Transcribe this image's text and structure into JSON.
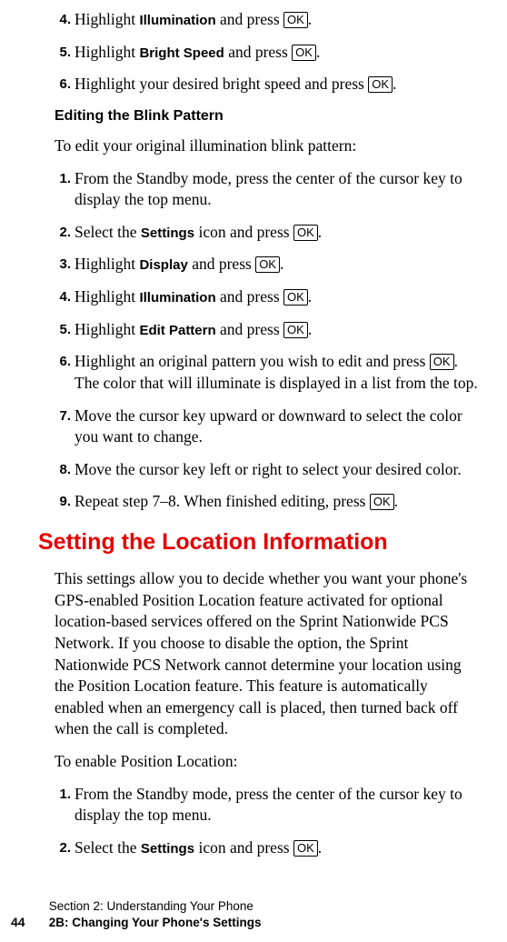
{
  "ok_label": "OK",
  "pre_steps": [
    {
      "n": "4.",
      "pre": "Highlight ",
      "bold": "Illumination",
      "mid": " and press ",
      "ok": true,
      "after": "."
    },
    {
      "n": "5.",
      "pre": "Highlight ",
      "bold": "Bright Speed",
      "mid": " and press ",
      "ok": true,
      "after": "."
    },
    {
      "n": "6.",
      "pre": "Highlight your desired bright speed and press ",
      "bold": "",
      "mid": "",
      "ok": true,
      "after": "."
    }
  ],
  "blink_heading": "Editing the Blink Pattern",
  "blink_intro": "To edit your original illumination blink pattern:",
  "blink_steps": [
    {
      "n": "1.",
      "text_a": "From the Standby mode, press the center of the cursor key to display the top menu."
    },
    {
      "n": "2.",
      "pre": "Select the ",
      "bold": "Settings",
      "mid": " icon and press ",
      "ok": true,
      "after": "."
    },
    {
      "n": "3.",
      "pre": "Highlight ",
      "bold": "Display",
      "mid": " and press ",
      "ok": true,
      "after": "."
    },
    {
      "n": "4.",
      "pre": "Highlight ",
      "bold": "Illumination",
      "mid": " and press ",
      "ok": true,
      "after": "."
    },
    {
      "n": "5.",
      "pre": "Highlight ",
      "bold": "Edit Pattern",
      "mid": " and press ",
      "ok": true,
      "after": "."
    },
    {
      "n": "6.",
      "pre": "Highlight an original pattern you wish to edit and press ",
      "ok": true,
      "after": ".",
      "line2": "The color that will illuminate is displayed in a list from the top."
    },
    {
      "n": "7.",
      "text_a": "Move the cursor key upward or downward to select the color you want to change."
    },
    {
      "n": "8.",
      "text_a": "Move the cursor key left or right to select your desired color."
    },
    {
      "n": "9.",
      "pre": "Repeat step 7–8. When finished editing, press ",
      "ok": true,
      "after": "."
    }
  ],
  "section_title": "Setting the Location Information",
  "section_para": "This settings allow you to decide whether you want your phone's GPS-enabled Position Location feature activated for optional location-based services offered on the Sprint Nationwide PCS Network. If you choose to disable the option, the Sprint Nationwide PCS Network cannot determine your location using the Position Location feature. This feature is automatically enabled when an emergency call is placed, then turned back off when the call is completed.",
  "enable_intro": "To enable Position Location:",
  "enable_steps": [
    {
      "n": "1.",
      "text_a": "From the Standby mode, press the center of the cursor key to display the top menu."
    },
    {
      "n": "2.",
      "pre": "Select the ",
      "bold": "Settings",
      "mid": " icon and press ",
      "ok": true,
      "after": "."
    }
  ],
  "footer": {
    "page": "44",
    "line1": "Section 2: Understanding Your Phone",
    "line2": "2B: Changing Your Phone's Settings"
  }
}
